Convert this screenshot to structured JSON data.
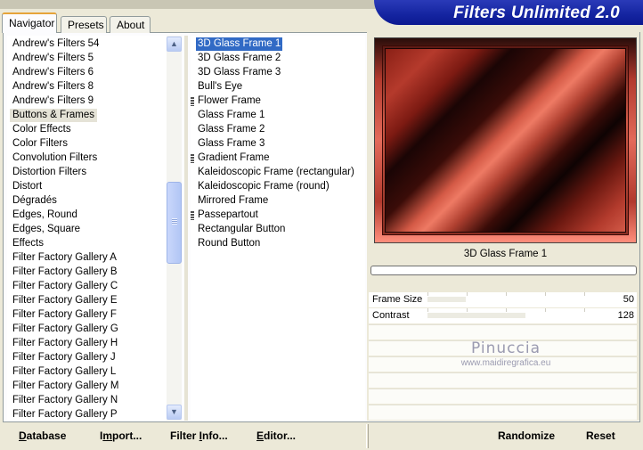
{
  "app": {
    "title": "Filters Unlimited 2.0"
  },
  "tabs": [
    {
      "label": "Navigator",
      "active": true
    },
    {
      "label": "Presets",
      "active": false
    },
    {
      "label": "About",
      "active": false
    }
  ],
  "categories": {
    "selected": "Buttons & Frames",
    "items": [
      "Andrew's Filters 54",
      "Andrew's Filters 5",
      "Andrew's Filters 6",
      "Andrew's Filters 8",
      "Andrew's Filters 9",
      "Buttons & Frames",
      "Color Effects",
      "Color Filters",
      "Convolution Filters",
      "Distortion Filters",
      "Distort",
      "Dégradés",
      "Edges, Round",
      "Edges, Square",
      "Effects",
      "Filter Factory Gallery A",
      "Filter Factory Gallery B",
      "Filter Factory Gallery C",
      "Filter Factory Gallery E",
      "Filter Factory Gallery F",
      "Filter Factory Gallery G",
      "Filter Factory Gallery H",
      "Filter Factory Gallery J",
      "Filter Factory Gallery L",
      "Filter Factory Gallery M",
      "Filter Factory Gallery N",
      "Filter Factory Gallery P"
    ]
  },
  "filters": {
    "selected": "3D Glass Frame 1",
    "items": [
      {
        "label": "3D Glass Frame 1",
        "marked": false
      },
      {
        "label": "3D Glass Frame 2",
        "marked": false
      },
      {
        "label": "3D Glass Frame 3",
        "marked": false
      },
      {
        "label": "Bull's Eye",
        "marked": false
      },
      {
        "label": "Flower Frame",
        "marked": true
      },
      {
        "label": "Glass Frame 1",
        "marked": false
      },
      {
        "label": "Glass Frame 2",
        "marked": false
      },
      {
        "label": "Glass Frame 3",
        "marked": false
      },
      {
        "label": "Gradient Frame",
        "marked": true
      },
      {
        "label": "Kaleidoscopic Frame (rectangular)",
        "marked": false
      },
      {
        "label": "Kaleidoscopic Frame (round)",
        "marked": false
      },
      {
        "label": "Mirrored Frame",
        "marked": false
      },
      {
        "label": "Passepartout",
        "marked": true
      },
      {
        "label": "Rectangular Button",
        "marked": false
      },
      {
        "label": "Round Button",
        "marked": false
      }
    ]
  },
  "preview": {
    "caption": "3D Glass Frame 1"
  },
  "parameters": [
    {
      "label": "Frame Size",
      "value": "50",
      "fraction": 0.196
    },
    {
      "label": "Contrast",
      "value": "128",
      "fraction": 0.502
    }
  ],
  "watermark": {
    "name": "Pinuccia",
    "url": "www.maidiregrafica.eu"
  },
  "buttons": {
    "database": {
      "underline": "D",
      "rest": "atabase"
    },
    "import": {
      "pre": "I",
      "underline": "m",
      "rest": "port..."
    },
    "filter_info": {
      "pre": "Filter ",
      "underline": "I",
      "rest": "nfo..."
    },
    "editor": {
      "underline": "E",
      "rest": "ditor..."
    },
    "randomize": "Randomize",
    "reset": "Reset"
  },
  "colors": {
    "banner": "#1424a0",
    "selection": "#316ac5",
    "panel": "#ece9d8",
    "tab_accent": "#e6a43a"
  },
  "icons": {
    "scroll_up": "▲",
    "scroll_down": "▼"
  }
}
